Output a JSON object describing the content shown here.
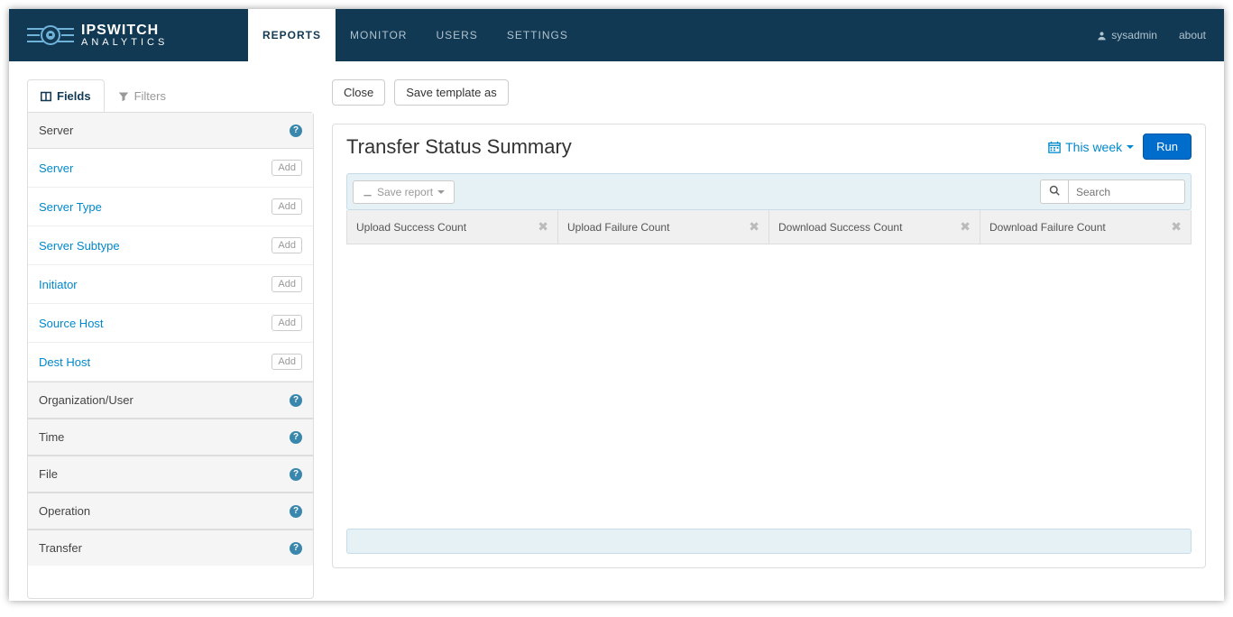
{
  "brand": {
    "line1": "IPSWITCH",
    "line2": "ANALYTICS"
  },
  "nav": {
    "items": [
      {
        "label": "REPORTS",
        "active": true
      },
      {
        "label": "MONITOR",
        "active": false
      },
      {
        "label": "USERS",
        "active": false
      },
      {
        "label": "SETTINGS",
        "active": false
      }
    ],
    "user": "sysadmin",
    "about": "about"
  },
  "sidebar": {
    "tabs": {
      "fields": "Fields",
      "filters": "Filters"
    },
    "add_label": "Add",
    "groups": [
      {
        "label": "Server",
        "expanded": true,
        "items": [
          "Server",
          "Server Type",
          "Server Subtype",
          "Initiator",
          "Source Host",
          "Dest Host"
        ]
      },
      {
        "label": "Organization/User",
        "expanded": false
      },
      {
        "label": "Time",
        "expanded": false
      },
      {
        "label": "File",
        "expanded": false
      },
      {
        "label": "Operation",
        "expanded": false
      },
      {
        "label": "Transfer",
        "expanded": false
      }
    ]
  },
  "toolbar": {
    "close": "Close",
    "save_template": "Save template as"
  },
  "report": {
    "title": "Transfer Status Summary",
    "date_range": "This week",
    "run": "Run",
    "save_report": "Save report",
    "search_placeholder": "Search",
    "columns": [
      "Upload Success Count",
      "Upload Failure Count",
      "Download Success Count",
      "Download Failure Count"
    ]
  }
}
